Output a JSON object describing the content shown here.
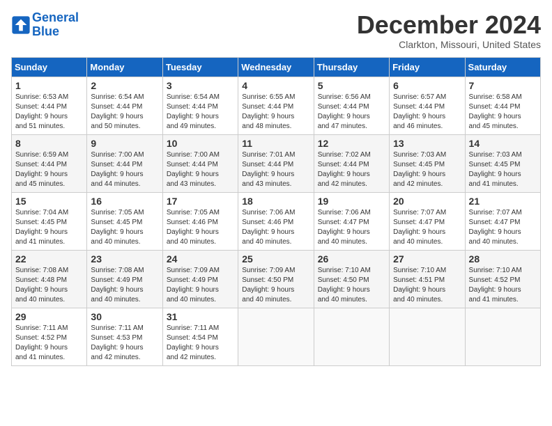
{
  "logo": {
    "line1": "General",
    "line2": "Blue"
  },
  "title": "December 2024",
  "location": "Clarkton, Missouri, United States",
  "days_of_week": [
    "Sunday",
    "Monday",
    "Tuesday",
    "Wednesday",
    "Thursday",
    "Friday",
    "Saturday"
  ],
  "weeks": [
    [
      {
        "day": "1",
        "info": "Sunrise: 6:53 AM\nSunset: 4:44 PM\nDaylight: 9 hours\nand 51 minutes."
      },
      {
        "day": "2",
        "info": "Sunrise: 6:54 AM\nSunset: 4:44 PM\nDaylight: 9 hours\nand 50 minutes."
      },
      {
        "day": "3",
        "info": "Sunrise: 6:54 AM\nSunset: 4:44 PM\nDaylight: 9 hours\nand 49 minutes."
      },
      {
        "day": "4",
        "info": "Sunrise: 6:55 AM\nSunset: 4:44 PM\nDaylight: 9 hours\nand 48 minutes."
      },
      {
        "day": "5",
        "info": "Sunrise: 6:56 AM\nSunset: 4:44 PM\nDaylight: 9 hours\nand 47 minutes."
      },
      {
        "day": "6",
        "info": "Sunrise: 6:57 AM\nSunset: 4:44 PM\nDaylight: 9 hours\nand 46 minutes."
      },
      {
        "day": "7",
        "info": "Sunrise: 6:58 AM\nSunset: 4:44 PM\nDaylight: 9 hours\nand 45 minutes."
      }
    ],
    [
      {
        "day": "8",
        "info": "Sunrise: 6:59 AM\nSunset: 4:44 PM\nDaylight: 9 hours\nand 45 minutes."
      },
      {
        "day": "9",
        "info": "Sunrise: 7:00 AM\nSunset: 4:44 PM\nDaylight: 9 hours\nand 44 minutes."
      },
      {
        "day": "10",
        "info": "Sunrise: 7:00 AM\nSunset: 4:44 PM\nDaylight: 9 hours\nand 43 minutes."
      },
      {
        "day": "11",
        "info": "Sunrise: 7:01 AM\nSunset: 4:44 PM\nDaylight: 9 hours\nand 43 minutes."
      },
      {
        "day": "12",
        "info": "Sunrise: 7:02 AM\nSunset: 4:44 PM\nDaylight: 9 hours\nand 42 minutes."
      },
      {
        "day": "13",
        "info": "Sunrise: 7:03 AM\nSunset: 4:45 PM\nDaylight: 9 hours\nand 42 minutes."
      },
      {
        "day": "14",
        "info": "Sunrise: 7:03 AM\nSunset: 4:45 PM\nDaylight: 9 hours\nand 41 minutes."
      }
    ],
    [
      {
        "day": "15",
        "info": "Sunrise: 7:04 AM\nSunset: 4:45 PM\nDaylight: 9 hours\nand 41 minutes."
      },
      {
        "day": "16",
        "info": "Sunrise: 7:05 AM\nSunset: 4:45 PM\nDaylight: 9 hours\nand 40 minutes."
      },
      {
        "day": "17",
        "info": "Sunrise: 7:05 AM\nSunset: 4:46 PM\nDaylight: 9 hours\nand 40 minutes."
      },
      {
        "day": "18",
        "info": "Sunrise: 7:06 AM\nSunset: 4:46 PM\nDaylight: 9 hours\nand 40 minutes."
      },
      {
        "day": "19",
        "info": "Sunrise: 7:06 AM\nSunset: 4:47 PM\nDaylight: 9 hours\nand 40 minutes."
      },
      {
        "day": "20",
        "info": "Sunrise: 7:07 AM\nSunset: 4:47 PM\nDaylight: 9 hours\nand 40 minutes."
      },
      {
        "day": "21",
        "info": "Sunrise: 7:07 AM\nSunset: 4:47 PM\nDaylight: 9 hours\nand 40 minutes."
      }
    ],
    [
      {
        "day": "22",
        "info": "Sunrise: 7:08 AM\nSunset: 4:48 PM\nDaylight: 9 hours\nand 40 minutes."
      },
      {
        "day": "23",
        "info": "Sunrise: 7:08 AM\nSunset: 4:49 PM\nDaylight: 9 hours\nand 40 minutes."
      },
      {
        "day": "24",
        "info": "Sunrise: 7:09 AM\nSunset: 4:49 PM\nDaylight: 9 hours\nand 40 minutes."
      },
      {
        "day": "25",
        "info": "Sunrise: 7:09 AM\nSunset: 4:50 PM\nDaylight: 9 hours\nand 40 minutes."
      },
      {
        "day": "26",
        "info": "Sunrise: 7:10 AM\nSunset: 4:50 PM\nDaylight: 9 hours\nand 40 minutes."
      },
      {
        "day": "27",
        "info": "Sunrise: 7:10 AM\nSunset: 4:51 PM\nDaylight: 9 hours\nand 40 minutes."
      },
      {
        "day": "28",
        "info": "Sunrise: 7:10 AM\nSunset: 4:52 PM\nDaylight: 9 hours\nand 41 minutes."
      }
    ],
    [
      {
        "day": "29",
        "info": "Sunrise: 7:11 AM\nSunset: 4:52 PM\nDaylight: 9 hours\nand 41 minutes."
      },
      {
        "day": "30",
        "info": "Sunrise: 7:11 AM\nSunset: 4:53 PM\nDaylight: 9 hours\nand 42 minutes."
      },
      {
        "day": "31",
        "info": "Sunrise: 7:11 AM\nSunset: 4:54 PM\nDaylight: 9 hours\nand 42 minutes."
      },
      {
        "day": "",
        "info": ""
      },
      {
        "day": "",
        "info": ""
      },
      {
        "day": "",
        "info": ""
      },
      {
        "day": "",
        "info": ""
      }
    ]
  ]
}
